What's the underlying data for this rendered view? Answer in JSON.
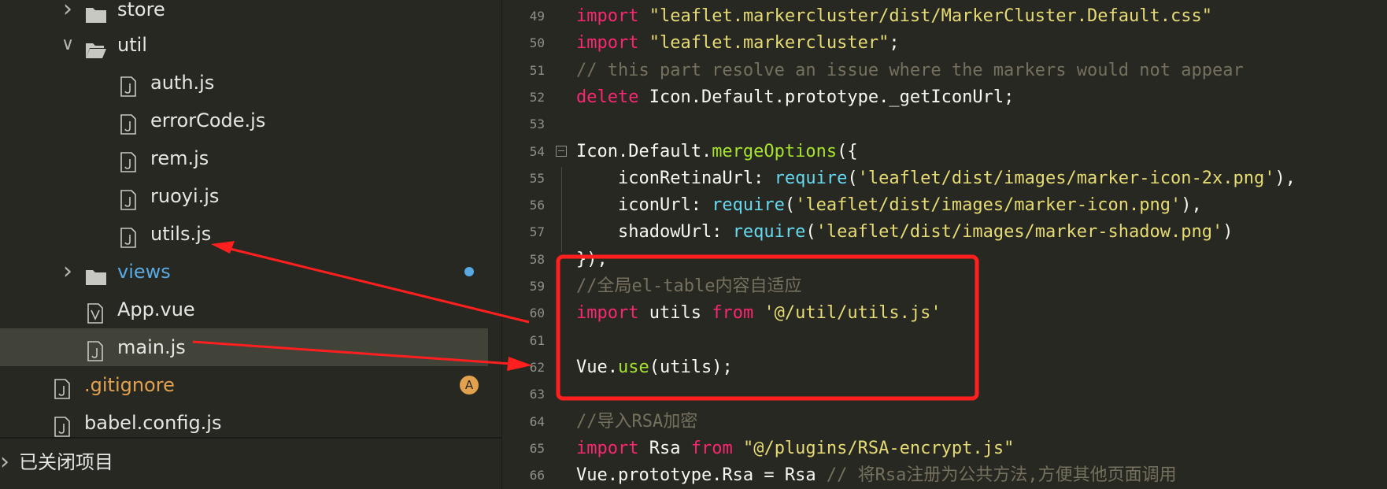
{
  "sidebar": {
    "items": [
      {
        "label": "store",
        "type": "folder",
        "expanded": false
      },
      {
        "label": "util",
        "type": "folder",
        "expanded": true
      },
      {
        "label": "auth.js",
        "type": "file"
      },
      {
        "label": "errorCode.js",
        "type": "file"
      },
      {
        "label": "rem.js",
        "type": "file"
      },
      {
        "label": "ruoyi.js",
        "type": "file"
      },
      {
        "label": "utils.js",
        "type": "file"
      },
      {
        "label": "views",
        "type": "folder",
        "expanded": false,
        "status": "modified"
      },
      {
        "label": "App.vue",
        "type": "vue-file"
      },
      {
        "label": "main.js",
        "type": "file",
        "selected": true
      },
      {
        "label": ".gitignore",
        "type": "file",
        "badge": "A"
      },
      {
        "label": "babel.config.js",
        "type": "file"
      }
    ],
    "closed_projects_label": "已关闭项目"
  },
  "editor": {
    "lines": [
      {
        "n": "49",
        "tokens": [
          [
            "kw",
            "import"
          ],
          [
            "pl",
            " "
          ],
          [
            "str",
            "\"leaflet.markercluster/dist/MarkerCluster.Default.css\""
          ]
        ]
      },
      {
        "n": "50",
        "tokens": [
          [
            "kw",
            "import"
          ],
          [
            "pl",
            " "
          ],
          [
            "str",
            "\"leaflet.markercluster\""
          ],
          [
            "pl",
            ";"
          ]
        ]
      },
      {
        "n": "51",
        "tokens": [
          [
            "cmt",
            "// this part resolve an issue where the markers would not appear"
          ]
        ]
      },
      {
        "n": "52",
        "tokens": [
          [
            "kw",
            "delete"
          ],
          [
            "pl",
            " Icon.Default.prototype._getIconUrl;"
          ]
        ]
      },
      {
        "n": "53",
        "tokens": []
      },
      {
        "n": "54",
        "tokens": [
          [
            "pl",
            "Icon.Default."
          ],
          [
            "fn",
            "mergeOptions"
          ],
          [
            "pl",
            "({"
          ]
        ]
      },
      {
        "n": "55",
        "tokens": [
          [
            "pl",
            "    iconRetinaUrl: "
          ],
          [
            "bi",
            "require"
          ],
          [
            "pl",
            "("
          ],
          [
            "str",
            "'leaflet/dist/images/marker-icon-2x.png'"
          ],
          [
            "pl",
            "),"
          ]
        ]
      },
      {
        "n": "56",
        "tokens": [
          [
            "pl",
            "    iconUrl: "
          ],
          [
            "bi",
            "require"
          ],
          [
            "pl",
            "("
          ],
          [
            "str",
            "'leaflet/dist/images/marker-icon.png'"
          ],
          [
            "pl",
            "),"
          ]
        ]
      },
      {
        "n": "57",
        "tokens": [
          [
            "pl",
            "    shadowUrl: "
          ],
          [
            "bi",
            "require"
          ],
          [
            "pl",
            "("
          ],
          [
            "str",
            "'leaflet/dist/images/marker-shadow.png'"
          ],
          [
            "pl",
            ")"
          ]
        ]
      },
      {
        "n": "58",
        "tokens": [
          [
            "pl",
            "});"
          ]
        ]
      },
      {
        "n": "59",
        "tokens": [
          [
            "cmt",
            "//全局el-table内容自适应"
          ]
        ]
      },
      {
        "n": "60",
        "tokens": [
          [
            "kw",
            "import"
          ],
          [
            "pl",
            " utils "
          ],
          [
            "kw",
            "from"
          ],
          [
            "pl",
            " "
          ],
          [
            "str",
            "'@/util/utils.js'"
          ]
        ]
      },
      {
        "n": "61",
        "tokens": []
      },
      {
        "n": "62",
        "tokens": [
          [
            "pl",
            "Vue."
          ],
          [
            "fn",
            "use"
          ],
          [
            "pl",
            "(utils);"
          ]
        ]
      },
      {
        "n": "63",
        "tokens": []
      },
      {
        "n": "64",
        "tokens": [
          [
            "cmt",
            "//导入RSA加密"
          ]
        ]
      },
      {
        "n": "65",
        "tokens": [
          [
            "kw",
            "import"
          ],
          [
            "pl",
            " Rsa "
          ],
          [
            "kw",
            "from"
          ],
          [
            "pl",
            " "
          ],
          [
            "str",
            "\"@/plugins/RSA-encrypt.js\""
          ]
        ]
      },
      {
        "n": "66",
        "tokens": [
          [
            "pl",
            "Vue.prototype.Rsa = Rsa "
          ],
          [
            "cmt",
            "// 将Rsa注册为公共方法,方便其他页面调用"
          ]
        ]
      }
    ]
  },
  "colors": {
    "background": "#272822",
    "keyword": "#f92672",
    "string": "#e6db74",
    "comment": "#75715e",
    "function": "#a6e22e",
    "builtin": "#66d9ef",
    "annotation": "#ff1f1f",
    "folder_modified": "#58a9e4",
    "git_added": "#e2a14f"
  },
  "icons": {
    "folder": "folder-icon",
    "folder_open": "folder-open-icon",
    "file": "js-file-icon",
    "vue": "vue-file-icon",
    "chevron_right": "chevron-right-icon",
    "chevron_down": "chevron-down-icon"
  }
}
